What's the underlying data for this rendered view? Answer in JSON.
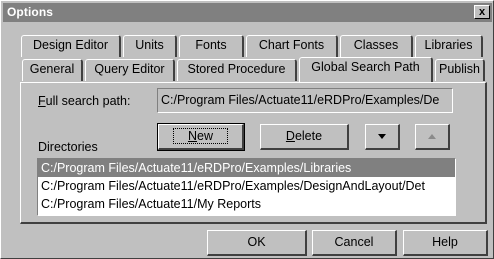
{
  "window": {
    "title": "Options",
    "close_label": "x"
  },
  "tabs_row1": [
    {
      "label": "Design Editor"
    },
    {
      "label": "Units"
    },
    {
      "label": "Fonts"
    },
    {
      "label": "Chart Fonts"
    },
    {
      "label": "Classes"
    },
    {
      "label": "Libraries"
    }
  ],
  "tabs_row2": [
    {
      "label": "General"
    },
    {
      "label": "Query Editor"
    },
    {
      "label": "Stored Procedure"
    },
    {
      "label": "Global Search Path",
      "active": true
    },
    {
      "label": "Publish"
    }
  ],
  "search_path": {
    "label_prefix": "F",
    "label_rest": "ull search path:",
    "value": "C:/Program Files/Actuate11/eRDPro/Examples/De"
  },
  "directories": {
    "label": "Directories",
    "new_prefix": "N",
    "new_rest": "ew",
    "delete_prefix": "D",
    "delete_rest": "elete",
    "move_down_icon": "arrow-down-icon",
    "move_up_icon": "arrow-up-icon",
    "items": [
      "C:/Program Files/Actuate11/eRDPro/Examples/Libraries",
      "C:/Program Files/Actuate11/eRDPro/Examples/DesignAndLayout/Det",
      "C:/Program Files/Actuate11/My Reports"
    ],
    "selected_index": 0
  },
  "footer": {
    "ok_label": "OK",
    "cancel_label": "Cancel",
    "help_label": "Help"
  }
}
